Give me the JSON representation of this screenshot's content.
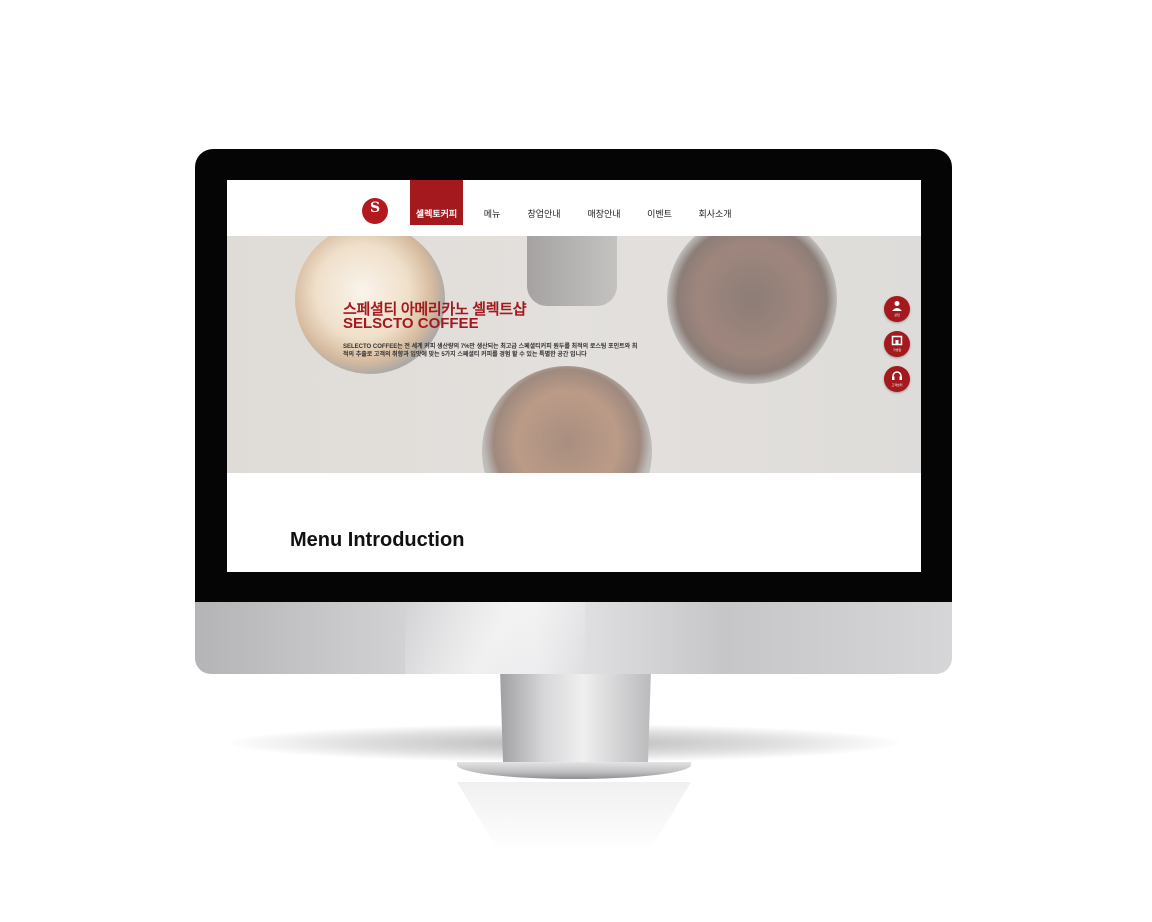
{
  "nav": {
    "brand_label": "셀렉토커피",
    "items": [
      "메뉴",
      "창업안내",
      "매장안내",
      "이벤트",
      "회사소개"
    ]
  },
  "hero": {
    "title": "스페셜티 아메리카노 셀렉트샵",
    "subtitle": "SELSCTO COFFEE",
    "description": "SELECTO COFFEE는 전 세계 커피 생산량의 7%만 생산되는 최고급 스페셜티커피 원두를 최적의 로스팅 포인트와 최적의 추출로 고객의 취향과 입맛에 맞는 5가지 스페셜티 커피를 경험 할 수 있는 특별한 공간 입니다"
  },
  "quick_menu": [
    {
      "label": "상담",
      "icon": "consult-icon"
    },
    {
      "label": "가맹점",
      "icon": "store-icon"
    },
    {
      "label": "고객센터",
      "icon": "headset-icon"
    }
  ],
  "section": {
    "title": "Menu Introduction"
  },
  "colors": {
    "brand_red": "#a3191d",
    "bezel": "#050505"
  }
}
